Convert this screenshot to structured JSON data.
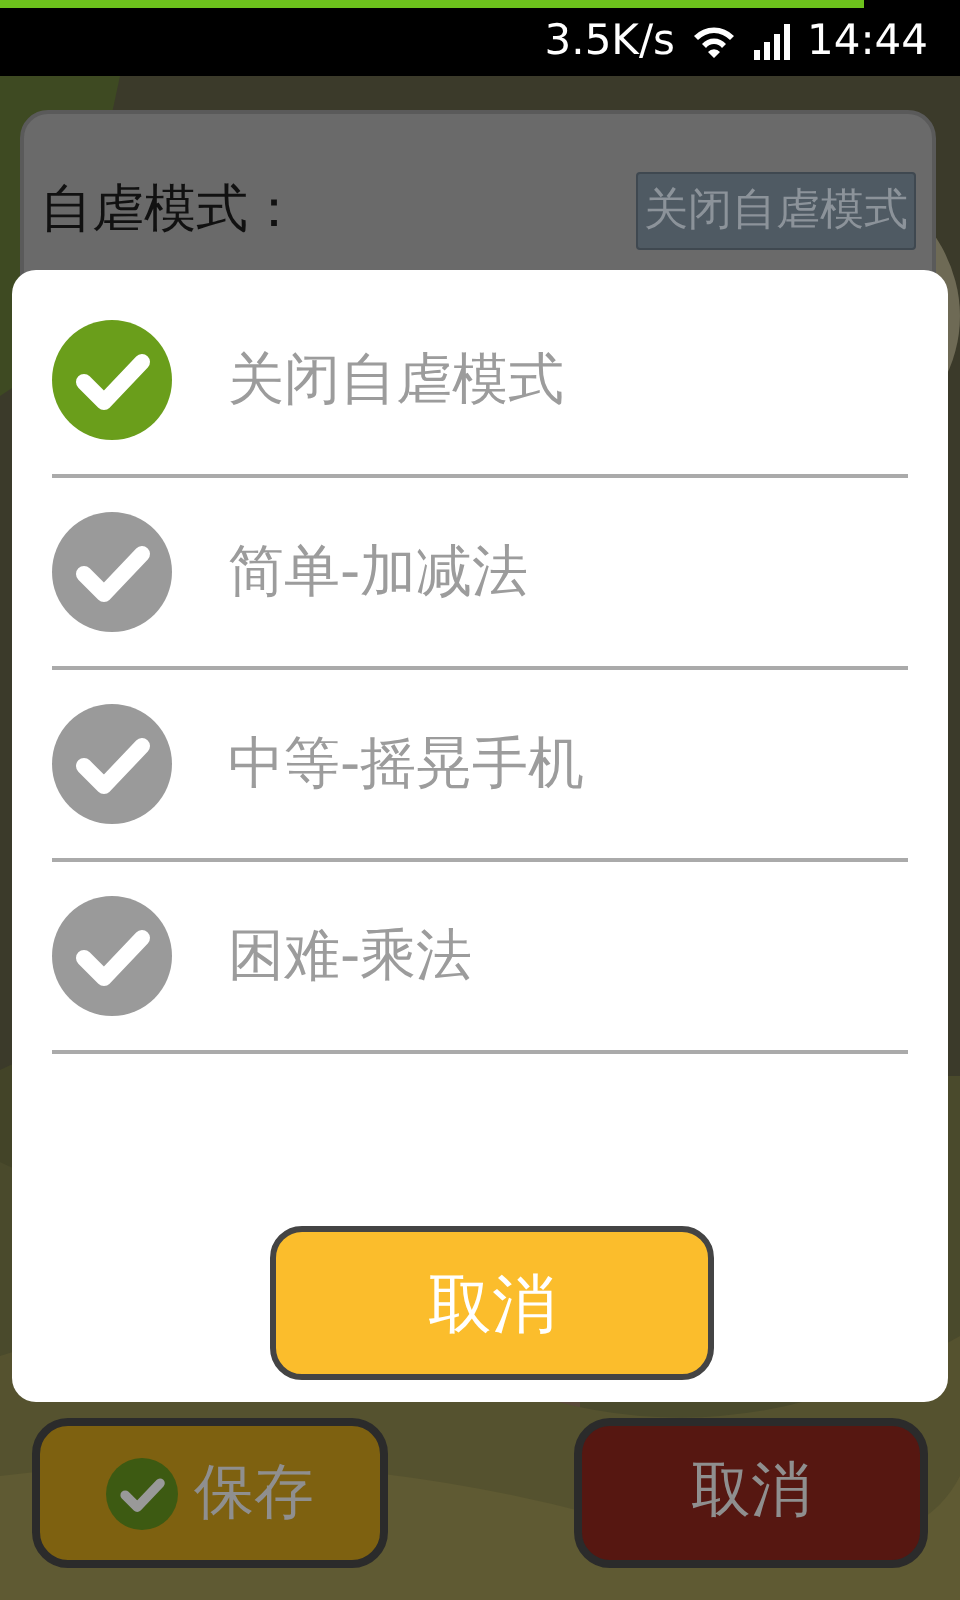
{
  "status_bar": {
    "progress": {
      "level": 0.9
    },
    "speed": "3.5K/s",
    "time": "14:44"
  },
  "settings": {
    "label": "自虐模式：",
    "value": "关闭自虐模式"
  },
  "dialog": {
    "options": [
      {
        "label": "关闭自虐模式",
        "selected": true
      },
      {
        "label": "简单-加减法",
        "selected": false
      },
      {
        "label": "中等-摇晃手机",
        "selected": false
      },
      {
        "label": "困难-乘法",
        "selected": false
      }
    ],
    "cancel": "取消"
  },
  "footer": {
    "save": "保存",
    "cancel": "取消"
  }
}
